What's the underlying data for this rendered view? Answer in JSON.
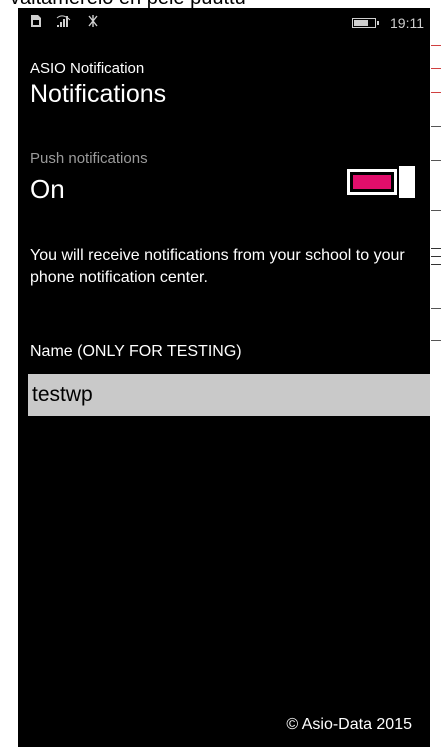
{
  "caption": "valtamerelo en pele puuttu",
  "status_bar": {
    "icons": [
      "sim-icon",
      "signal-icon",
      "data-icon"
    ],
    "time": "19:11"
  },
  "app": {
    "name": "ASIO Notification",
    "page_title": "Notifications"
  },
  "push": {
    "label": "Push notifications",
    "state": "On",
    "accent": "#e10e6b"
  },
  "info_text": "You will receive notifications from your school to your phone notification center.",
  "name_field": {
    "label": "Name (ONLY FOR TESTING)",
    "value": "testwp"
  },
  "footer": "© Asio-Data 2015"
}
